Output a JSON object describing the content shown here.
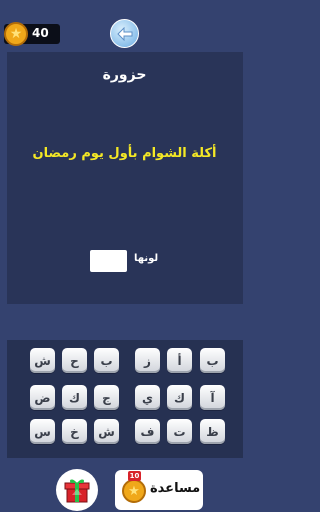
{
  "header": {
    "coins": "40",
    "coin_icon": "star-coin-icon",
    "back_icon": "back-arrow-icon"
  },
  "question": {
    "label": "حزورة",
    "text": "أكلة الشوام بأول يوم رمضان",
    "answer_hint": "لونها"
  },
  "keyboard": {
    "rows": [
      [
        "ب",
        "أ",
        "ز",
        "ب",
        "ح",
        "ش"
      ],
      [
        "آ",
        "ك",
        "ي",
        "ج",
        "ك",
        "ض"
      ],
      [
        "ظ",
        "ت",
        "ف",
        "ش",
        "خ",
        "س"
      ]
    ]
  },
  "footer": {
    "help_label": "مساعدة",
    "help_cost": "10",
    "gift_icon": "gift-box-icon"
  },
  "colors": {
    "background": "#34426f",
    "panel": "#293458",
    "question_text": "#f4e825",
    "coin": "#f0a81a"
  }
}
